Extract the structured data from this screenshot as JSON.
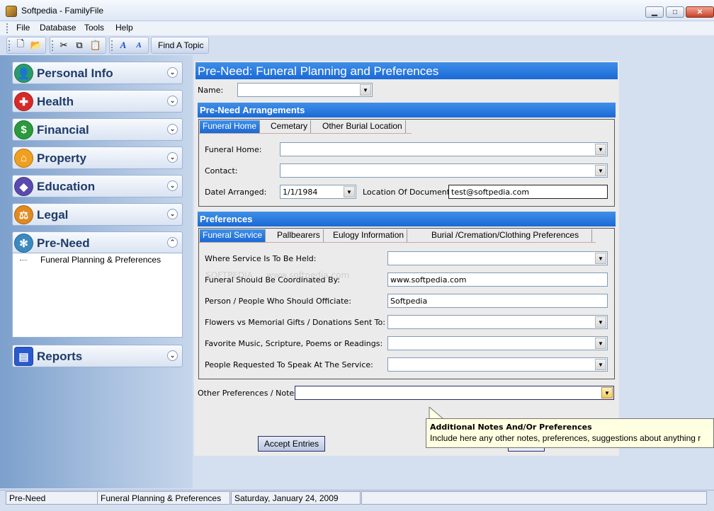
{
  "window": {
    "title": "Softpedia - FamilyFile"
  },
  "menu": [
    "File",
    "Database",
    "Tools",
    "Help"
  ],
  "toolbar": {
    "find_topic": "Find A Topic"
  },
  "sidebar": {
    "items": [
      {
        "label": "Personal Info",
        "icon": "person-icon",
        "color": "#2a9a6c"
      },
      {
        "label": "Health",
        "icon": "red-cross-icon",
        "color": "#d62a2a"
      },
      {
        "label": "Financial",
        "icon": "dollar-icon",
        "color": "#2a9a3c"
      },
      {
        "label": "Property",
        "icon": "house-icon",
        "color": "#f0a020"
      },
      {
        "label": "Education",
        "icon": "graduation-cap-icon",
        "color": "#5a4ab0"
      },
      {
        "label": "Legal",
        "icon": "scales-icon",
        "color": "#e08a20"
      },
      {
        "label": "Pre-Need",
        "icon": "angel-icon",
        "color": "#3a8ac0"
      },
      {
        "label": "Reports",
        "icon": "report-icon",
        "color": "#2a5ad0"
      }
    ],
    "sub_item": "Funeral Planning & Preferences"
  },
  "main": {
    "title": "Pre-Need: Funeral Planning and Preferences",
    "name_label": "Name:",
    "name_value": "",
    "arrangements": {
      "header": "Pre-Need Arrangements",
      "tabs": [
        "Funeral Home",
        "Cemetary",
        "Other Burial Location"
      ],
      "funeral_home_label": "Funeral Home:",
      "contact_label": "Contact:",
      "date_label": "Datel Arranged:",
      "date_value": "1/1/1984",
      "location_label": "Location Of Documents:",
      "location_value": "test@softpedia.com"
    },
    "preferences": {
      "header": "Preferences",
      "tabs": [
        "Funeral Service",
        "Pallbearers",
        "Eulogy Information",
        "Burial /Cremation/Clothing Preferences"
      ],
      "fields": [
        {
          "label": "Where Service Is To Be Held:",
          "value": ""
        },
        {
          "label": "Funeral Should Be Coordinated By:",
          "value": "www.softpedia.com"
        },
        {
          "label": "Person / People Who Should Officiate:",
          "value": "Softpedia"
        },
        {
          "label": "Flowers vs Memorial Gifts / Donations Sent To:",
          "value": ""
        },
        {
          "label": "Favorite Music, Scripture, Poems or Readings:",
          "value": ""
        },
        {
          "label": "People Requested To Speak At The Service:",
          "value": ""
        }
      ]
    },
    "other_notes_label": "Other Preferences / Notes:",
    "accept_button": "Accept Entries",
    "tooltip": {
      "title": "Additional Notes And/Or Preferences",
      "text": "Include here any other notes, preferences, suggestions about anything r"
    },
    "watermark": "SOFTPEDIA ... www.softpedia.com"
  },
  "status": [
    "Pre-Need",
    "Funeral Planning & Preferences",
    "Saturday, January 24, 2009",
    ""
  ]
}
